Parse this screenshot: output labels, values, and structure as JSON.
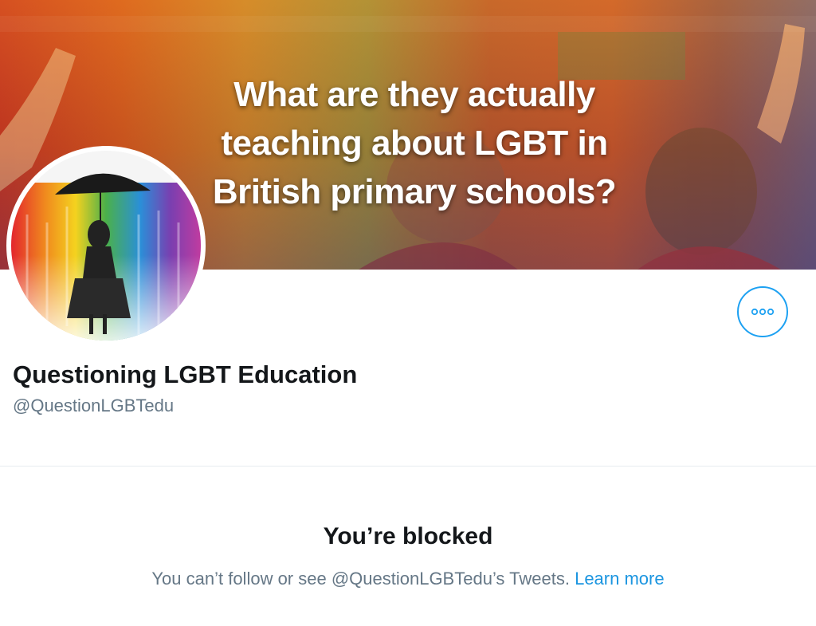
{
  "banner": {
    "title": "What are they actually teaching about LGBT in British primary schools?"
  },
  "profile": {
    "display_name": "Questioning LGBT Education",
    "handle": "@QuestionLGBTedu"
  },
  "blocked": {
    "title": "You’re blocked",
    "message": "You can’t follow or see @QuestionLGBTedu’s Tweets.",
    "link": "Learn more"
  },
  "colors": {
    "accent": "#1da1f2",
    "link": "#1b95e0",
    "text_primary": "#14171a",
    "text_secondary": "#657786"
  },
  "icons": {
    "more": "more-dots-icon"
  }
}
